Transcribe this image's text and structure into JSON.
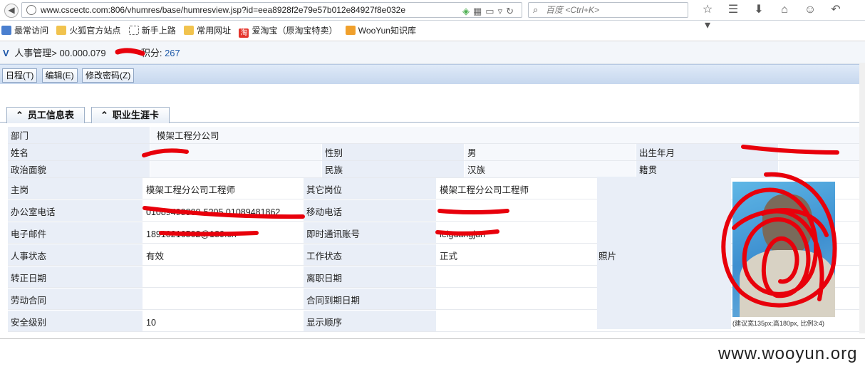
{
  "browser": {
    "url": "www.cscectc.com:806/vhumres/base/humresview.jsp?id=eea8928f2e79e57b012e84927f8e032e",
    "search_placeholder": "百度 <Ctrl+K>",
    "bookmarks": [
      "最常访问",
      "火狐官方站点",
      "新手上路",
      "常用网址",
      "爱淘宝（原淘宝特卖）",
      "WooYun知识库"
    ],
    "taobao_badge": "淘"
  },
  "app": {
    "breadcrumb": "人事管理> 00.000.079",
    "score_label": "积分:",
    "score_value": "267",
    "menu": [
      "日程(T)",
      "编辑(E)",
      "修改密码(Z)"
    ]
  },
  "tabs": [
    "员工信息表",
    "职业生涯卡"
  ],
  "fields": {
    "dept_label": "部门",
    "dept_value": "模架工程分公司",
    "name_label": "姓名",
    "gender_label": "性别",
    "gender_value": "男",
    "birth_label": "出生年月",
    "politic_label": "政治面貌",
    "ethnic_label": "民族",
    "ethnic_value": "汉族",
    "native_label": "籍贯",
    "main_post_label": "主岗",
    "main_post_value": "模架工程分公司工程师",
    "other_post_label": "其它岗位",
    "other_post_value": "模架工程分公司工程师",
    "office_phone_label": "办公室电话",
    "office_phone_value": "01089498800-5205 01089481862",
    "mobile_label": "移动电话",
    "email_label": "电子邮件",
    "email_value": "18910216502@189.cn",
    "im_label": "即时通讯账号",
    "im_value": "leiguangjun",
    "hr_status_label": "人事状态",
    "hr_status_value": "有效",
    "work_status_label": "工作状态",
    "work_status_value": "正式",
    "photo_label": "照片",
    "regular_date_label": "转正日期",
    "leave_date_label": "离职日期",
    "labor_contract_label": "劳动合同",
    "contract_end_label": "合同到期日期",
    "security_label": "安全级别",
    "security_value": "10",
    "display_order_label": "显示顺序",
    "photo_note": "(建议宽135px;高180px, 比例3:4)"
  },
  "watermark": "www.wooyun.org",
  "colors": {
    "label_bg": "#e9eef7",
    "redaction": "#e8000b",
    "link": "#1f5aa8"
  }
}
